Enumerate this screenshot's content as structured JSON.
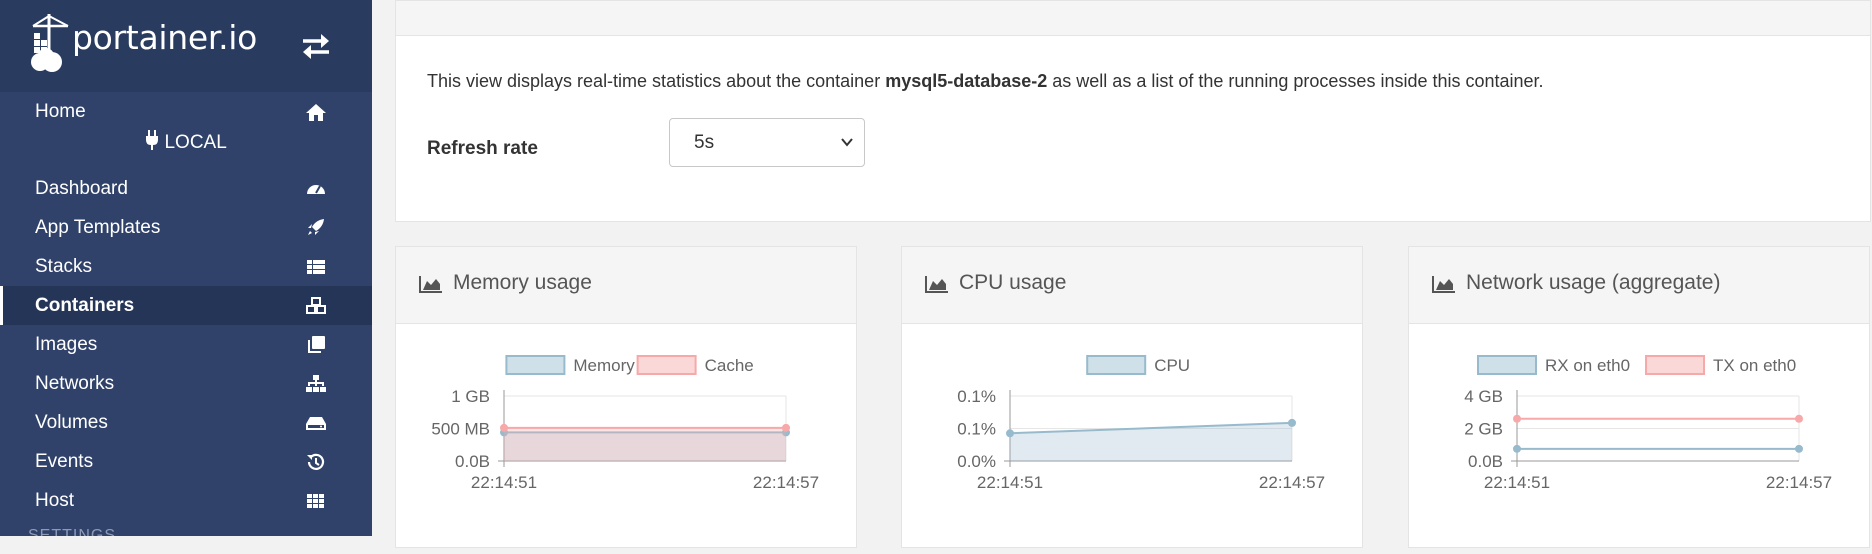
{
  "sidebar": {
    "logo_text": "portainer.io",
    "endpoint": "LOCAL",
    "settings_heading": "SETTINGS",
    "items": [
      {
        "label": "Home",
        "icon": "home-icon"
      },
      {
        "label": "Dashboard",
        "icon": "tachometer-icon"
      },
      {
        "label": "App Templates",
        "icon": "rocket-icon"
      },
      {
        "label": "Stacks",
        "icon": "th-list-icon"
      },
      {
        "label": "Containers",
        "icon": "cubes-icon"
      },
      {
        "label": "Images",
        "icon": "clone-icon"
      },
      {
        "label": "Networks",
        "icon": "sitemap-icon"
      },
      {
        "label": "Volumes",
        "icon": "hdd-icon"
      },
      {
        "label": "Events",
        "icon": "history-icon"
      },
      {
        "label": "Host",
        "icon": "th-icon"
      }
    ],
    "active": "Containers"
  },
  "stats": {
    "info_prefix": "This view displays real-time statistics about the container ",
    "container_name": "mysql5-database-2",
    "info_suffix": " as well as a list of the running processes inside this container.",
    "refresh_label": "Refresh rate",
    "refresh_value": "5s"
  },
  "colors": {
    "sidebar_bg": "#30426a",
    "series_blue": "#97bbcd",
    "series_red": "#f7a8a8"
  },
  "chart_data": [
    {
      "type": "area",
      "title": "Memory usage",
      "x": [
        "22:14:51",
        "22:14:57"
      ],
      "yticks": [
        "1 GB",
        "500 MB",
        "0.0B"
      ],
      "ylim": [
        0,
        1000
      ],
      "unit": "MB",
      "series": [
        {
          "name": "Memory",
          "values": [
            440,
            440
          ],
          "color": "#97bbcd"
        },
        {
          "name": "Cache",
          "values": [
            510,
            510
          ],
          "color": "#f7a8a8"
        }
      ],
      "legend": "top"
    },
    {
      "type": "area",
      "title": "CPU usage",
      "x": [
        "22:14:51",
        "22:14:57"
      ],
      "yticks": [
        "0.1%",
        "0.1%",
        "0.0%"
      ],
      "ylim": [
        0,
        0.15
      ],
      "unit": "%",
      "series": [
        {
          "name": "CPU",
          "values": [
            0.064,
            0.088
          ],
          "color": "#97bbcd"
        }
      ],
      "legend": "top"
    },
    {
      "type": "line",
      "title": "Network usage (aggregate)",
      "x": [
        "22:14:51",
        "22:14:57"
      ],
      "yticks": [
        "4 GB",
        "2 GB",
        "0.0B"
      ],
      "ylim": [
        0,
        4
      ],
      "unit": "GB",
      "series": [
        {
          "name": "RX on eth0",
          "values": [
            0.75,
            0.75
          ],
          "color": "#97bbcd"
        },
        {
          "name": "TX on eth0",
          "values": [
            2.6,
            2.6
          ],
          "color": "#f7a8a8"
        }
      ],
      "legend": "top"
    }
  ]
}
